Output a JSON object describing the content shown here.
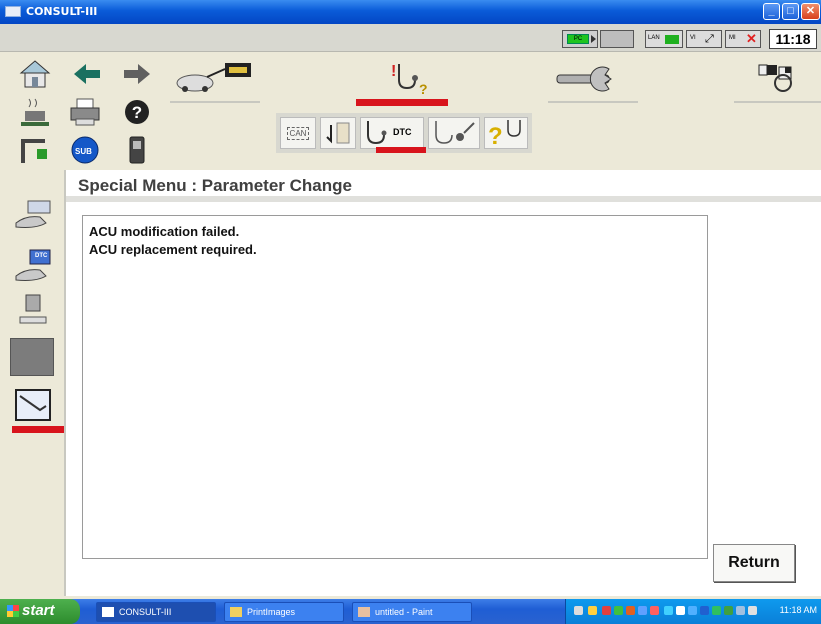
{
  "window": {
    "title": "CONSULT-III"
  },
  "status": {
    "clock": "11:18",
    "pc_label": "PC",
    "lan_label": "LAN",
    "vi_label": "VI",
    "mi_label": "MI"
  },
  "toolbar": {
    "sub_can_label": "CAN",
    "sub_dtc_label": "DTC",
    "sub_label": "SUB"
  },
  "main": {
    "title": "Special Menu : Parameter Change",
    "messages": [
      "ACU modification failed.",
      "ACU replacement required."
    ],
    "return_label": "Return"
  },
  "sidebar": {
    "dtc_label": "DTC"
  },
  "taskbar": {
    "start_label": "start",
    "tasks": [
      "CONSULT-III",
      "PrintImages",
      "untitled - Paint"
    ],
    "time": "11:18 AM"
  },
  "colors": {
    "accent_red": "#d8141c",
    "title_blue": "#0a5bd8"
  }
}
